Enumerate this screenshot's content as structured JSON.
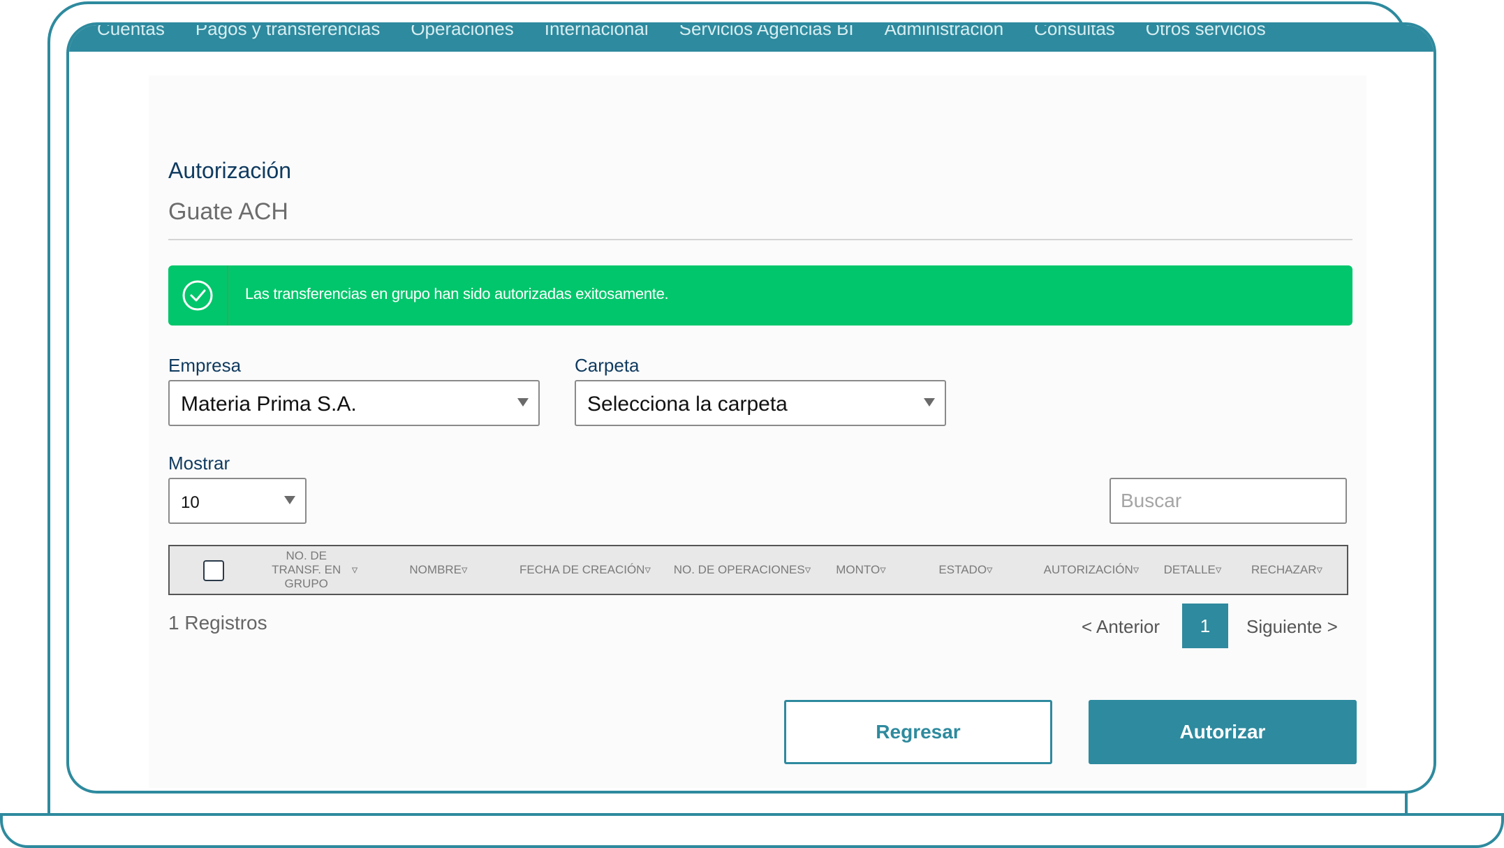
{
  "nav": {
    "items": [
      "Cuentas",
      "Pagos y transferencias",
      "Operaciones",
      "Internacional",
      "Servicios Agencias BI",
      "Administración",
      "Consultas",
      "Otros servicios"
    ]
  },
  "page": {
    "title": "Autorización",
    "subtitle": "Guate ACH"
  },
  "alert": {
    "message": "Las transferencias en grupo han sido autorizadas exitosamente.",
    "icon": "check-circle-icon",
    "color": "#02c66b"
  },
  "filters": {
    "empresa_label": "Empresa",
    "empresa_value": "Materia Prima S.A.",
    "carpeta_label": "Carpeta",
    "carpeta_value": "Selecciona la carpeta",
    "mostrar_label": "Mostrar",
    "mostrar_value": "10",
    "search_placeholder": "Buscar"
  },
  "table": {
    "columns": [
      "NO. DE TRANSF. EN GRUPO",
      "NOMBRE",
      "FECHA DE CREACIÓN",
      "NO. DE OPERACIONES",
      "MONTO",
      "ESTADO",
      "AUTORIZACIÓN",
      "DETALLE",
      "RECHAZAR"
    ]
  },
  "footer": {
    "records": "1 Registros",
    "prev": "< Anterior",
    "page": "1",
    "next": "Siguiente >"
  },
  "actions": {
    "back": "Regresar",
    "authorize": "Autorizar"
  },
  "colors": {
    "accent": "#2e8a9e",
    "success": "#02c66b",
    "title": "#0f3a5f"
  }
}
